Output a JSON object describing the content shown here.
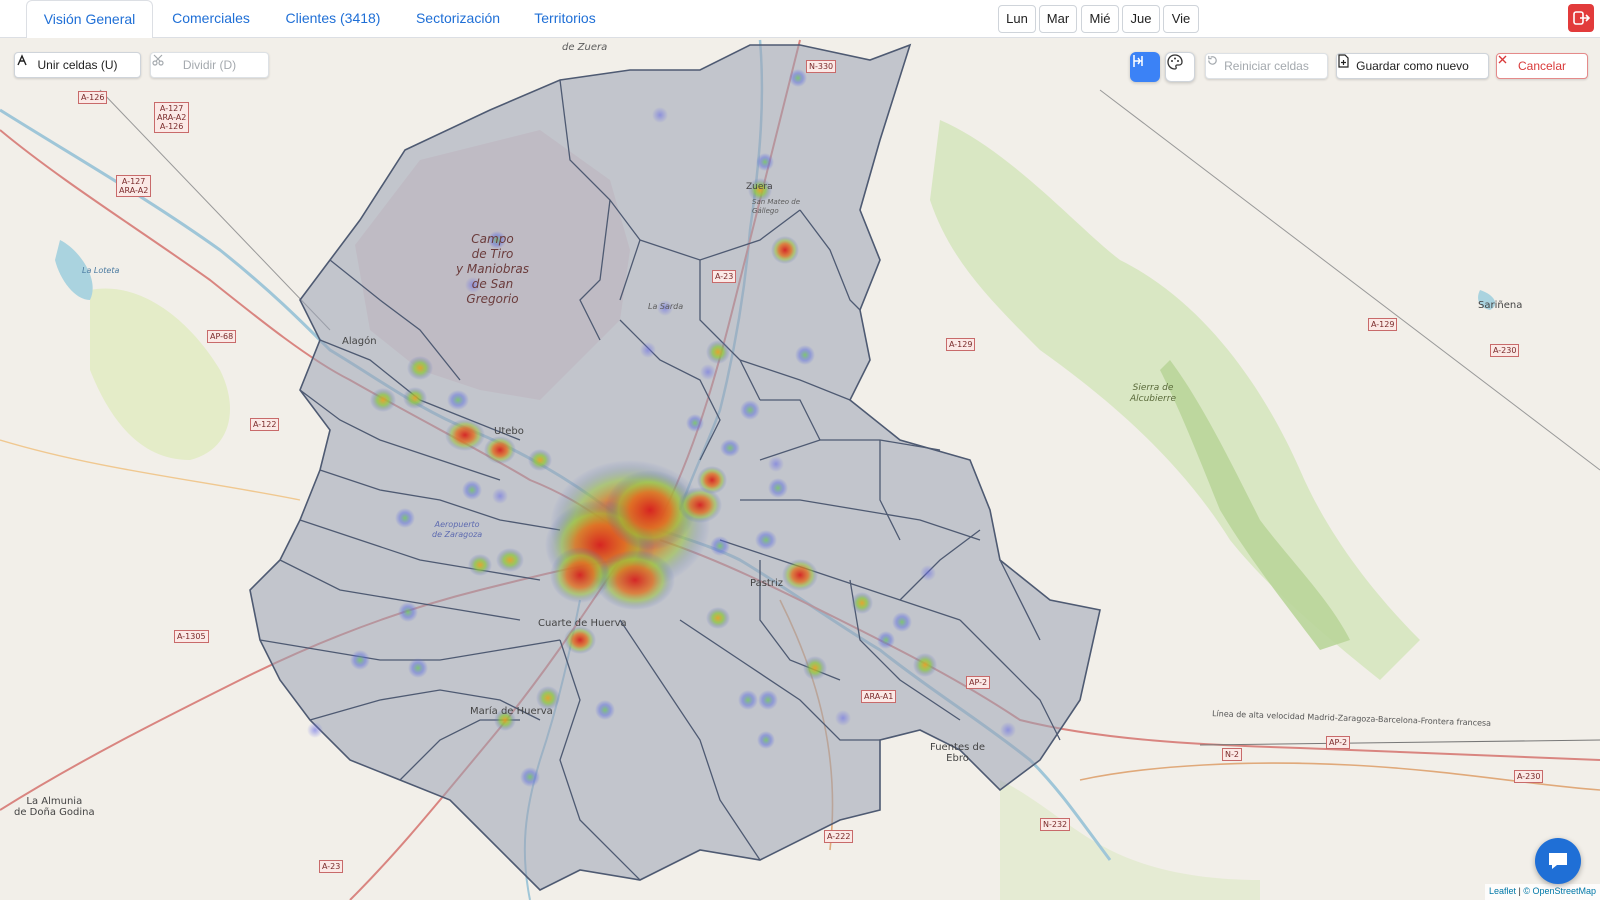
{
  "tabs": [
    {
      "label": "Visión General",
      "active": true
    },
    {
      "label": "Comerciales",
      "active": false
    },
    {
      "label": "Clientes (3418)",
      "active": false
    },
    {
      "label": "Sectorización",
      "active": false
    },
    {
      "label": "Territorios",
      "active": false
    }
  ],
  "days": [
    "Lun",
    "Mar",
    "Mié",
    "Jue",
    "Vie"
  ],
  "toolbar": {
    "merge_label": "Unir celdas (U)",
    "split_label": "Dividir (D)",
    "reset_label": "Reiniciar celdas",
    "save_new_label": "Guardar como nuevo",
    "cancel_label": "Cancelar"
  },
  "map": {
    "places": {
      "zuera": "de Zuera",
      "campo_1": "Campo",
      "campo_2": "de Tiro",
      "campo_3": "y Maniobras",
      "campo_4": "de San",
      "campo_5": "Gregorio",
      "alagon": "Alagón",
      "utebo": "Utebo",
      "aeropuerto_1": "Aeropuerto",
      "aeropuerto_2": "de Zaragoza",
      "cuarte": "Cuarte de Huerva",
      "maria": "María de Huerva",
      "pastriz": "Pastriz",
      "fuentes_1": "Fuentes de",
      "fuentes_2": "Ebro",
      "sarinena": "Sariñena",
      "sierra_1": "Sierra de",
      "sierra_2": "Alcubierre",
      "loteta": "La Loteta",
      "almunia_1": "La Almunia",
      "almunia_2": "de Doña Godina",
      "la_sarda": "La Sarda",
      "zuera_town": "Zuera",
      "san_mateo_1": "San Mateo de",
      "san_mateo_2": "Gállego",
      "linea": "Línea de alta velocidad Madrid-Zaragoza-Barcelona-Frontera francesa"
    },
    "shields": {
      "n330": "N-330",
      "a126": "A-126",
      "a127_1": "A-127",
      "a127_2": "ARA-A2",
      "a127_3": "A-126",
      "a127b_1": "A-127",
      "a127b_2": "ARA-A2",
      "ap68": "AP-68",
      "a122": "A-122",
      "a23_top": "A-23",
      "a129": "A-129",
      "a129b": "A-129",
      "a230": "A-230",
      "a230b": "A-230",
      "a1305": "A-1305",
      "ap2": "AP-2",
      "ap2b": "AP-2",
      "araa1": "ARA-A1",
      "n2": "N-2",
      "n232": "N-232",
      "a222": "A-222",
      "a23_bottom": "A-23"
    }
  },
  "attribution": {
    "leaflet": "Leaflet",
    "osm": "© OpenStreetMap"
  }
}
